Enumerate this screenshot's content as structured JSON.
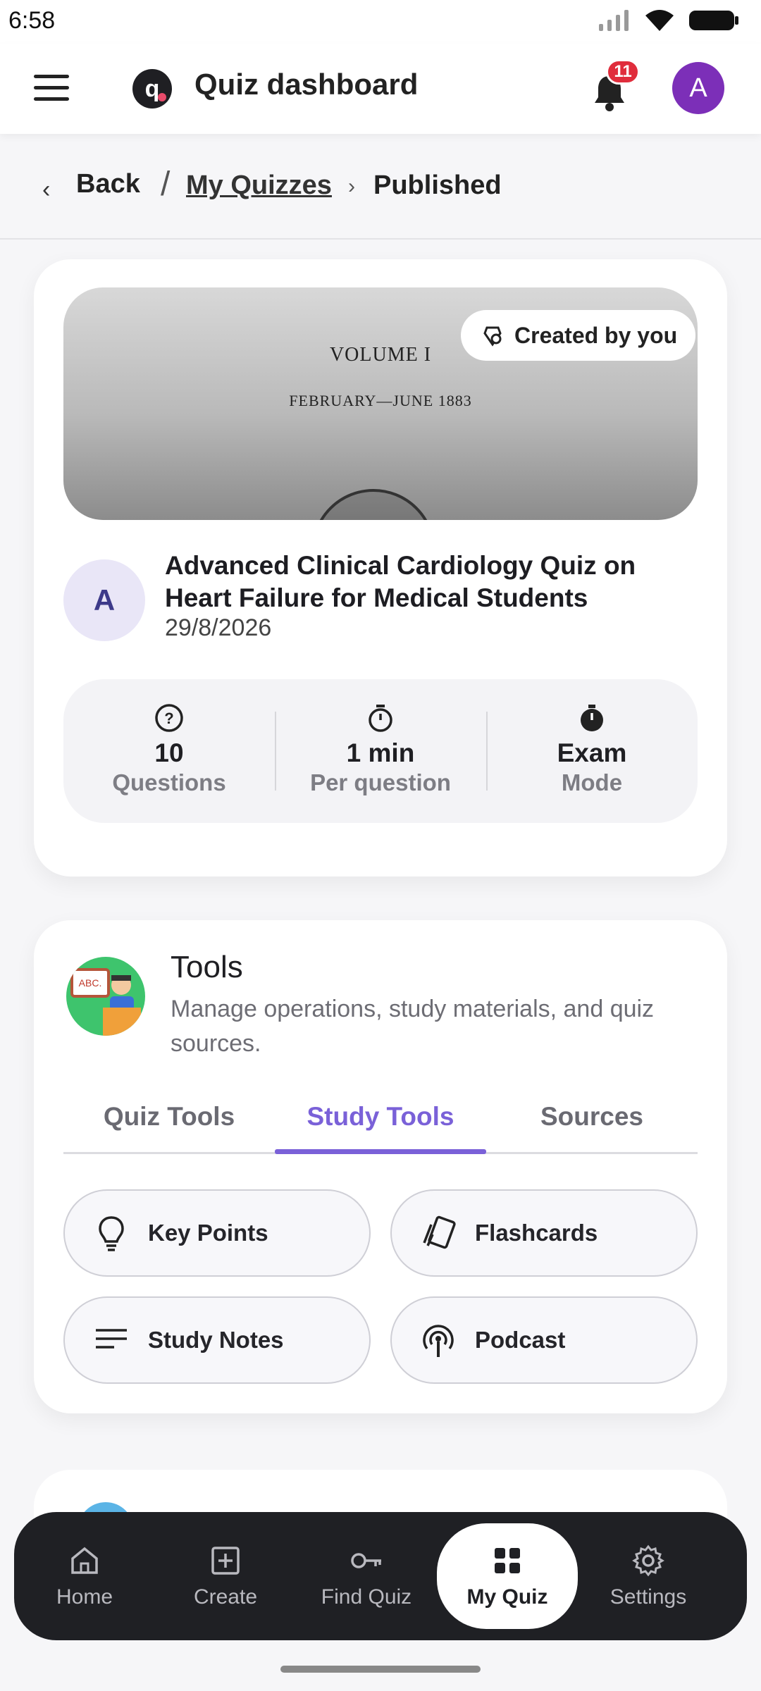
{
  "status": {
    "time": "6:58"
  },
  "header": {
    "title": "Quiz dashboard",
    "logo_letter": "q",
    "notification_count": "11",
    "avatar_letter": "A"
  },
  "breadcrumb": {
    "back": "Back",
    "slash": "/",
    "link": "My Quizzes",
    "current": "Published"
  },
  "quiz": {
    "cover_line1": "VOLUME I",
    "cover_line2": "FEBRUARY—JUNE 1883",
    "created_badge": "Created by you",
    "author_initial": "A",
    "title": "Advanced Clinical Cardiology Quiz on Heart Failure for Medical Students",
    "date": "29/8/2026",
    "stats": [
      {
        "value": "10",
        "label": "Questions",
        "icon": "question-circle-icon"
      },
      {
        "value": "1 min",
        "label": "Per question",
        "icon": "timer-icon"
      },
      {
        "value": "Exam",
        "label": "Mode",
        "icon": "stopwatch-icon"
      }
    ]
  },
  "tools": {
    "title": "Tools",
    "subtitle": "Manage operations, study materials, and quiz sources.",
    "tabs": [
      "Quiz Tools",
      "Study Tools",
      "Sources"
    ],
    "active_tab": "Study Tools",
    "items": [
      {
        "label": "Key Points",
        "icon": "lightbulb-icon"
      },
      {
        "label": "Flashcards",
        "icon": "flashcards-icon"
      },
      {
        "label": "Study Notes",
        "icon": "notes-lines-icon"
      },
      {
        "label": "Podcast",
        "icon": "podcast-icon"
      }
    ]
  },
  "nav": {
    "items": [
      "Home",
      "Create",
      "Find Quiz",
      "My Quiz",
      "Settings"
    ],
    "active": "My Quiz"
  },
  "colors": {
    "accent": "#7a61d8",
    "badge": "#e02d3c",
    "avatar": "#7c2fb8",
    "nav_bg": "#1f2024"
  }
}
